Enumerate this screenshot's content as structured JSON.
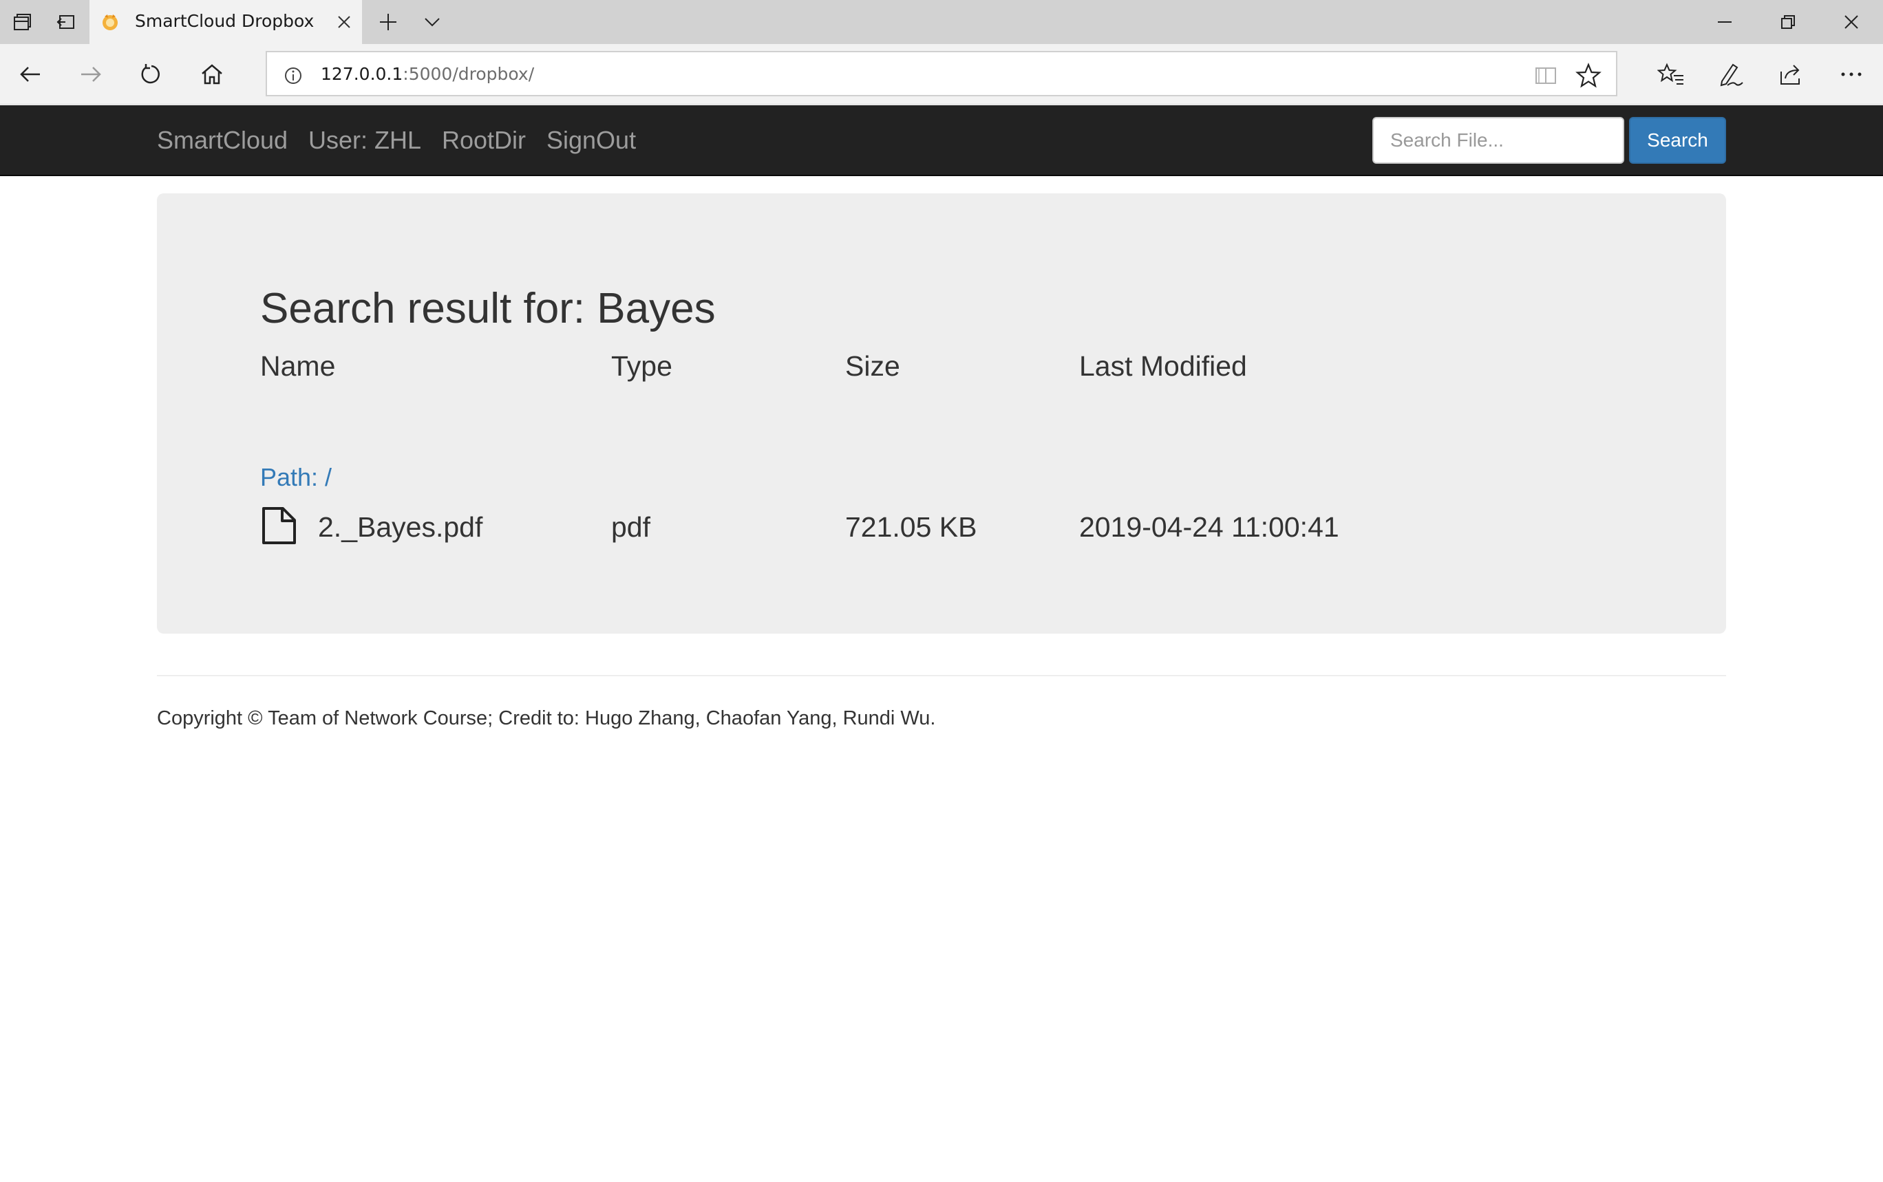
{
  "browser": {
    "tab": {
      "title": "SmartCloud Dropbox"
    },
    "address": {
      "host": "127.0.0.1",
      "rest": ":5000/dropbox/"
    }
  },
  "navbar": {
    "brand": "SmartCloud",
    "user": "User: ZHL",
    "rootdir": "RootDir",
    "signout": "SignOut",
    "search_placeholder": "Search File...",
    "search_button": "Search"
  },
  "results": {
    "title": "Search result for: Bayes",
    "headers": {
      "name": "Name",
      "type": "Type",
      "size": "Size",
      "modified": "Last Modified"
    },
    "path": "Path: /",
    "file": {
      "name": "2._Bayes.pdf",
      "type": "pdf",
      "size": "721.05 KB",
      "modified": "2019-04-24 11:00:41"
    }
  },
  "footer": {
    "copyright": "Copyright © Team of Network Course; Credit to: Hugo Zhang, Chaofan Yang, Rundi Wu."
  },
  "colors": {
    "navbar_bg": "#222222",
    "nav_text": "#9d9d9d",
    "accent": "#337ab7",
    "jumbotron_bg": "#eeeeee"
  },
  "icons": {
    "tabstrip": [
      "tab-manager-icon",
      "tabs-aside-icon",
      "favicon-icon",
      "close-icon",
      "new-tab-icon",
      "chevron-down-icon"
    ],
    "window": [
      "minimize-icon",
      "restore-icon",
      "close-window-icon"
    ],
    "toolbar": [
      "back-icon",
      "forward-icon",
      "refresh-icon",
      "home-icon",
      "info-icon",
      "reading-view-icon",
      "favorite-star-icon",
      "favorites-list-icon",
      "pen-icon",
      "share-icon",
      "more-icon"
    ],
    "content": [
      "file-icon"
    ]
  }
}
